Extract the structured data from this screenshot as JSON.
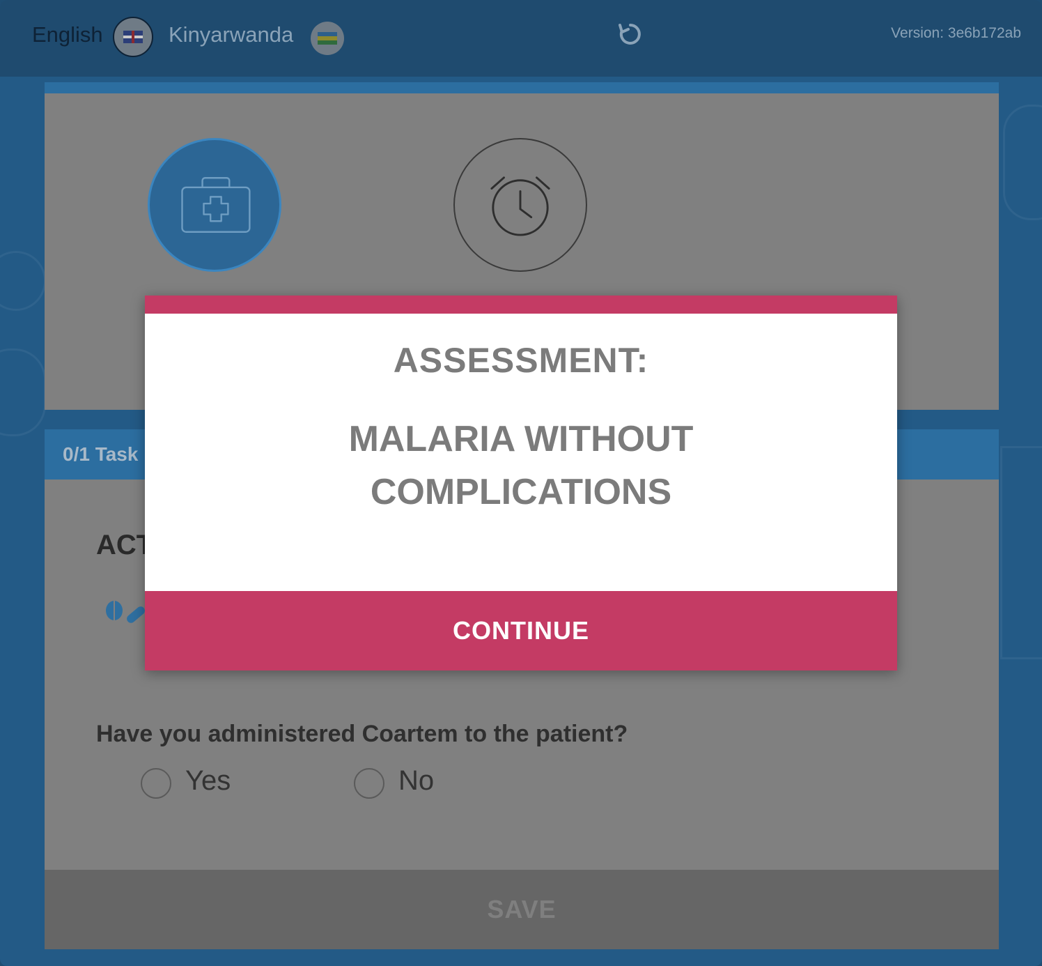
{
  "header": {
    "languages": [
      {
        "label": "English",
        "flag": "uk-flag"
      },
      {
        "label": "Kinyarwanda",
        "flag": "rwanda-flag"
      }
    ],
    "refresh_icon": "refresh-icon",
    "version": "Version: 3e6b172ab"
  },
  "steps": [
    {
      "icon": "medical-kit-icon",
      "state": "active"
    },
    {
      "icon": "alarm-clock-icon",
      "state": "pending"
    }
  ],
  "tasks": {
    "progress_text": "0/1 Task"
  },
  "section": {
    "title": "ACT",
    "icon": "pills-icon"
  },
  "question": {
    "text": "Have you administered Coartem to the patient?",
    "options": [
      "Yes",
      "No"
    ],
    "selected": null
  },
  "save_label": "SAVE",
  "modal": {
    "title": "ASSESSMENT:",
    "diagnosis_line1": "MALARIA WITHOUT",
    "diagnosis_line2": "COMPLICATIONS",
    "continue_label": "CONTINUE"
  },
  "colors": {
    "accent": "#c43b64",
    "primary_blue": "#2c6ea0",
    "background_blue": "#235a86",
    "overlay_gray": "#808080"
  }
}
